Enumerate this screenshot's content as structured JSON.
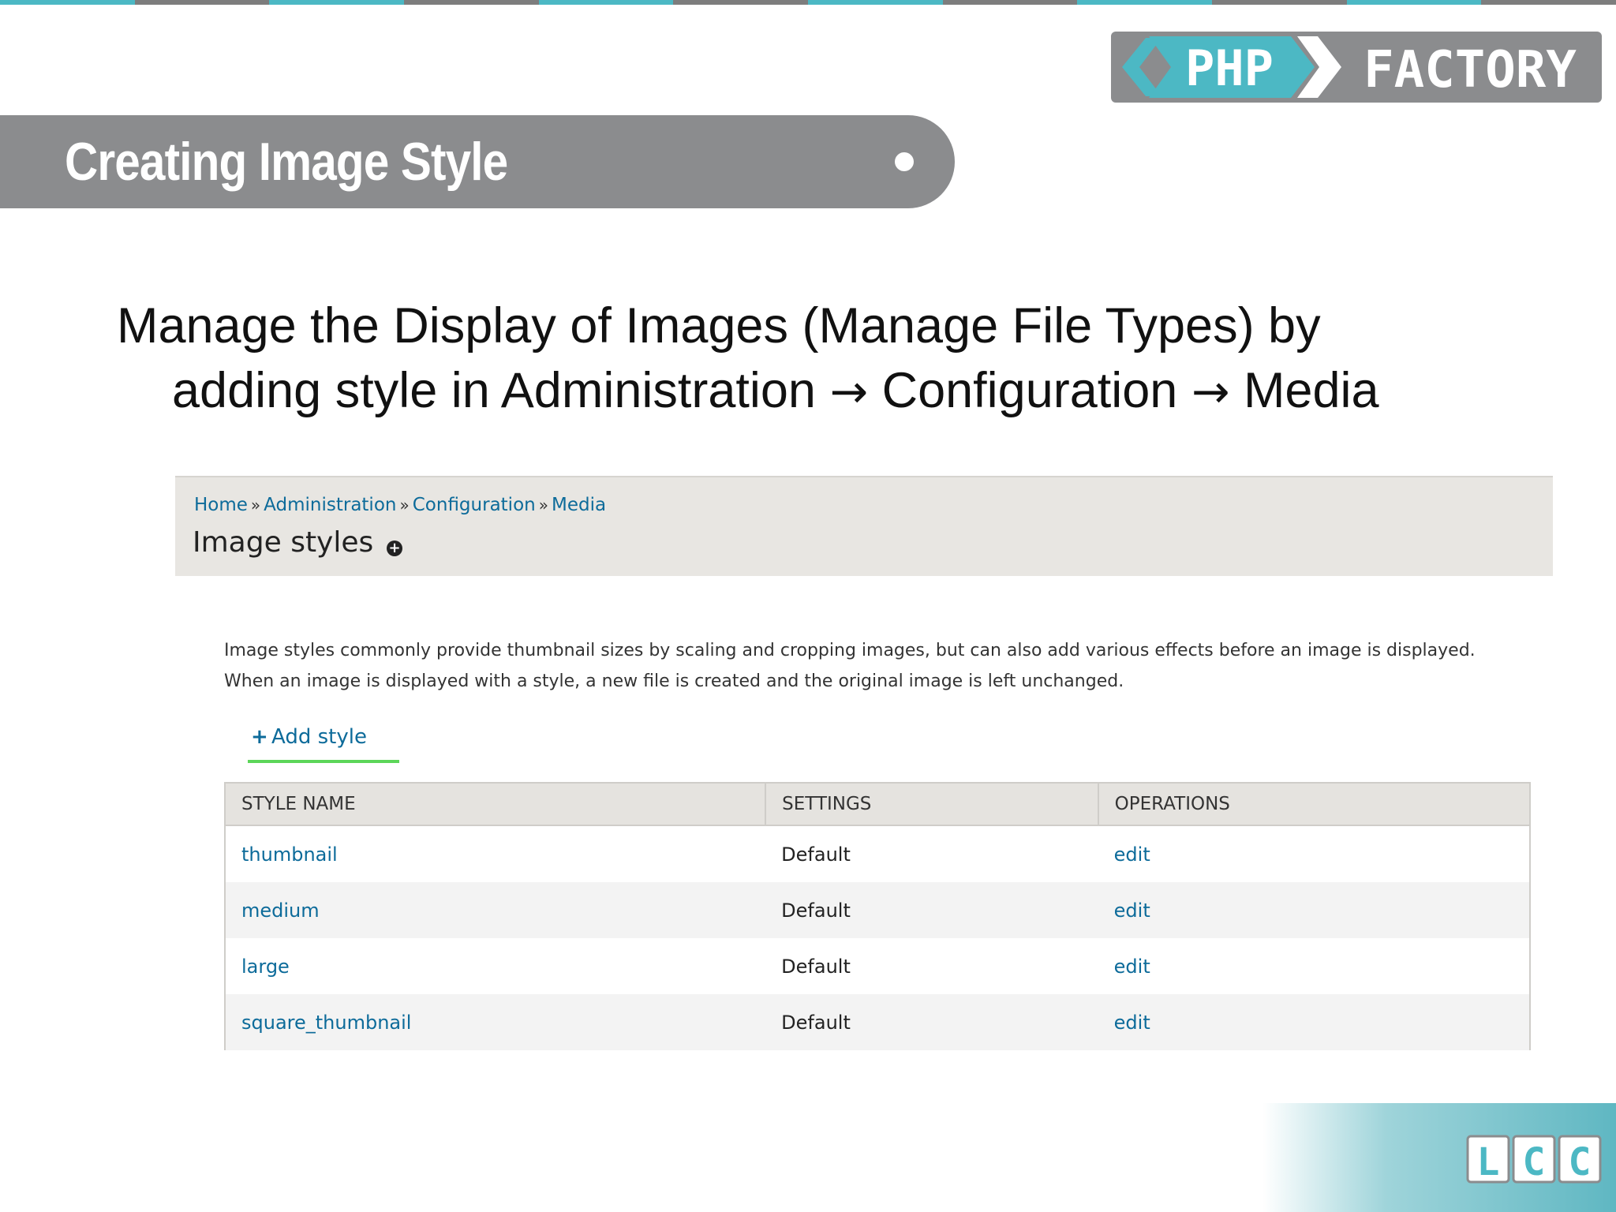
{
  "logo": {
    "left": "PHP",
    "right": "FACTORY"
  },
  "slide": {
    "title": "Creating Image Style",
    "bullet_line1": "Manage the Display of Images (Manage File Types) by",
    "bullet_line2_a": "adding style  in Administration ",
    "arrow": "→",
    "bullet_line2_b": " Configuration ",
    "bullet_line2_c": " Media"
  },
  "screenshot": {
    "breadcrumb": [
      "Home",
      "Administration",
      "Configuration",
      "Media"
    ],
    "breadcrumb_sep": "»",
    "heading": "Image styles",
    "shortcut_symbol": "+",
    "description_line1": "Image styles commonly provide thumbnail sizes by scaling and cropping images, but can also add various effects before an image is displayed.",
    "description_line2": "When an image is displayed with a style, a new file is created and the original image is left unchanged.",
    "add_style_label": "Add style",
    "add_style_symbol": "+",
    "table": {
      "headers": [
        "STYLE NAME",
        "SETTINGS",
        "OPERATIONS"
      ],
      "rows": [
        {
          "name": "thumbnail",
          "settings": "Default",
          "operation": "edit"
        },
        {
          "name": "medium",
          "settings": "Default",
          "operation": "edit"
        },
        {
          "name": "large",
          "settings": "Default",
          "operation": "edit"
        },
        {
          "name": "square_thumbnail",
          "settings": "Default",
          "operation": "edit"
        }
      ]
    }
  },
  "footer_logo": "LCC",
  "colors": {
    "accent": "#4cb8c4",
    "banner": "#8b8c8e",
    "link": "#0d6b9a",
    "add_underline": "#5cd659"
  }
}
